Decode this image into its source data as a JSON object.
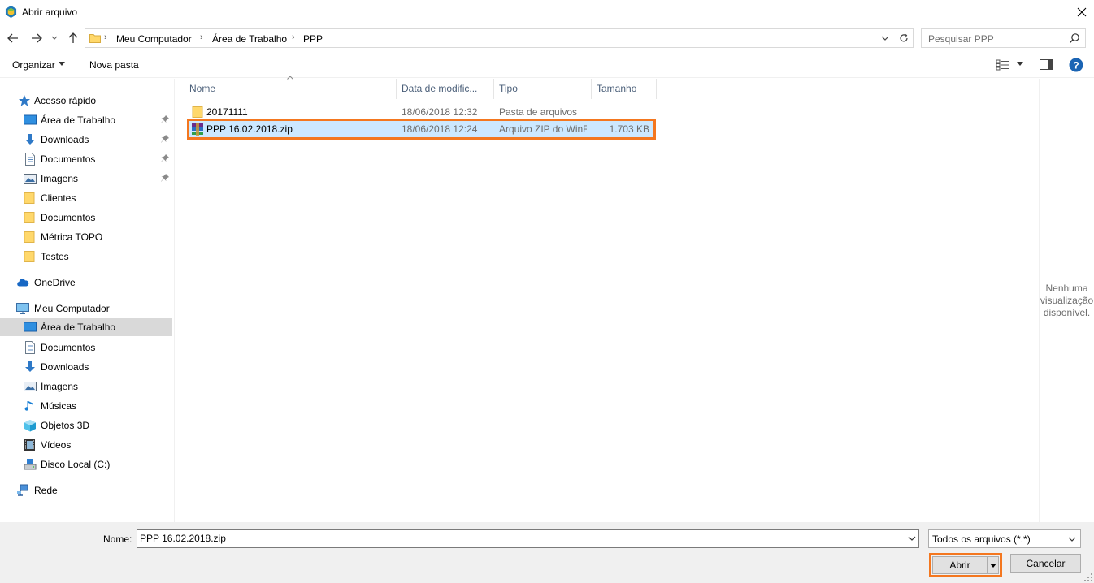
{
  "window": {
    "title": "Abrir arquivo"
  },
  "address": {
    "crumbs": [
      "Meu Computador",
      "Área de Trabalho",
      "PPP"
    ]
  },
  "search": {
    "placeholder": "Pesquisar PPP"
  },
  "toolbar": {
    "organize_label": "Organizar",
    "new_folder_label": "Nova pasta"
  },
  "sidebar": {
    "quick_access": "Acesso rápido",
    "quick_items": [
      {
        "label": "Área de Trabalho",
        "icon": "desktop-icon",
        "pinned": true
      },
      {
        "label": "Downloads",
        "icon": "download-icon",
        "pinned": true
      },
      {
        "label": "Documentos",
        "icon": "document-icon",
        "pinned": true
      },
      {
        "label": "Imagens",
        "icon": "pictures-icon",
        "pinned": true
      },
      {
        "label": "Clientes",
        "icon": "folder-icon",
        "pinned": false
      },
      {
        "label": "Documentos",
        "icon": "folder-icon",
        "pinned": false
      },
      {
        "label": "Métrica TOPO",
        "icon": "folder-icon",
        "pinned": false
      },
      {
        "label": "Testes",
        "icon": "folder-icon",
        "pinned": false
      }
    ],
    "onedrive": "OneDrive",
    "computer": "Meu Computador",
    "computer_items": [
      {
        "label": "Área de Trabalho",
        "icon": "desktop-icon",
        "selected": true
      },
      {
        "label": "Documentos",
        "icon": "document-icon"
      },
      {
        "label": "Downloads",
        "icon": "download-icon"
      },
      {
        "label": "Imagens",
        "icon": "pictures-icon"
      },
      {
        "label": "Músicas",
        "icon": "music-icon"
      },
      {
        "label": "Objetos 3D",
        "icon": "3d-objects-icon"
      },
      {
        "label": "Vídeos",
        "icon": "video-icon"
      },
      {
        "label": "Disco Local (C:)",
        "icon": "drive-icon"
      }
    ],
    "network": "Rede"
  },
  "columns": {
    "name": "Nome",
    "date": "Data de modific...",
    "type": "Tipo",
    "size": "Tamanho"
  },
  "files": [
    {
      "name": "20171111",
      "date": "18/06/2018 12:32",
      "type": "Pasta de arquivos",
      "size": "",
      "icon": "folder-icon"
    },
    {
      "name": "PPP 16.02.2018.zip",
      "date": "18/06/2018 12:24",
      "type": "Arquivo ZIP do WinRAR",
      "size": "1.703 KB",
      "icon": "winrar-icon",
      "selected": true
    }
  ],
  "preview": {
    "line1": "Nenhuma",
    "line2": "visualização",
    "line3": "disponível."
  },
  "bottom": {
    "name_label": "Nome:",
    "name_value": "PPP 16.02.2018.zip",
    "filter": "Todos os arquivos (*.*)",
    "open_label": "Abrir",
    "cancel_label": "Cancelar"
  },
  "colors": {
    "selection": "#cce8ff",
    "highlight": "#f4771f",
    "nav_selected": "#d9d9d9"
  }
}
